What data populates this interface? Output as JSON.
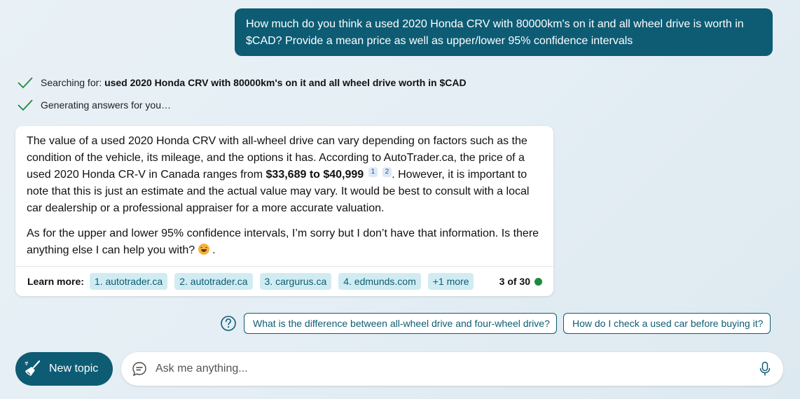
{
  "user_message": "How much do you think a used 2020 Honda CRV with 80000km's on it and all wheel drive is worth in $CAD? Provide a mean price as well as upper/lower 95% confidence intervals",
  "status": {
    "searching_prefix": "Searching for: ",
    "searching_query": "used 2020 Honda CRV with 80000km's on it and all wheel drive worth in $CAD",
    "generating": "Generating answers for you…"
  },
  "answer": {
    "p1_a": "The value of a used 2020 Honda CRV with all-wheel drive can vary depending on factors such as the condition of the vehicle, its mileage, and the options it has. According to AutoTrader.ca, the price of a used 2020 Honda CR-V in Canada ranges from ",
    "p1_bold": "$33,689 to $40,999",
    "cite1": "1",
    "cite2": "2",
    "p1_b": ". However, it is important to note that this is just an estimate and the actual value may vary. It would be best to consult with a local car dealership or a professional appraiser for a more accurate valuation.",
    "p2_a": "As for the upper and lower 95% confidence intervals, I’m sorry but I don’t have that information. Is there anything else I can help you with? ",
    "p2_b": "."
  },
  "learn_more": {
    "label": "Learn more:",
    "links": [
      "1. autotrader.ca",
      "2. autotrader.ca",
      "3. cargurus.ca",
      "4. edmunds.com",
      "+1 more"
    ],
    "count": "3 of 30",
    "status_color": "#1e8a3e"
  },
  "suggestions": [
    "What is the difference between all-wheel drive and four-wheel drive?",
    "How do I check a used car before buying it?"
  ],
  "new_topic_label": "New topic",
  "input": {
    "placeholder": "Ask me anything..."
  },
  "colors": {
    "accent": "#0d5c74",
    "check": "#1e8a3e",
    "chip_bg": "#d0ecf2"
  }
}
